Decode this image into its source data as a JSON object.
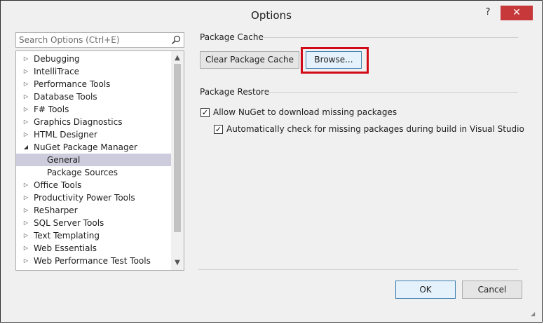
{
  "window": {
    "title": "Options",
    "help_label": "?",
    "close_label": "✕"
  },
  "search": {
    "placeholder": "Search Options (Ctrl+E)"
  },
  "tree": {
    "items": [
      {
        "label": "Debugging",
        "expanded": false,
        "level": 0
      },
      {
        "label": "IntelliTrace",
        "expanded": false,
        "level": 0
      },
      {
        "label": "Performance Tools",
        "expanded": false,
        "level": 0
      },
      {
        "label": "Database Tools",
        "expanded": false,
        "level": 0
      },
      {
        "label": "F# Tools",
        "expanded": false,
        "level": 0
      },
      {
        "label": "Graphics Diagnostics",
        "expanded": false,
        "level": 0
      },
      {
        "label": "HTML Designer",
        "expanded": false,
        "level": 0
      },
      {
        "label": "NuGet Package Manager",
        "expanded": true,
        "level": 0
      },
      {
        "label": "General",
        "level": 1,
        "selected": true
      },
      {
        "label": "Package Sources",
        "level": 1
      },
      {
        "label": "Office Tools",
        "expanded": false,
        "level": 0
      },
      {
        "label": "Productivity Power Tools",
        "expanded": false,
        "level": 0
      },
      {
        "label": "ReSharper",
        "expanded": false,
        "level": 0
      },
      {
        "label": "SQL Server Tools",
        "expanded": false,
        "level": 0
      },
      {
        "label": "Text Templating",
        "expanded": false,
        "level": 0
      },
      {
        "label": "Web Essentials",
        "expanded": false,
        "level": 0
      },
      {
        "label": "Web Performance Test Tools",
        "expanded": false,
        "level": 0
      }
    ]
  },
  "package_cache": {
    "section_label": "Package Cache",
    "clear_button": "Clear Package Cache",
    "browse_button": "Browse..."
  },
  "package_restore": {
    "section_label": "Package Restore",
    "allow_download_label": "Allow NuGet to download missing packages",
    "allow_download_checked": true,
    "auto_check_label": "Automatically check for missing packages during build in Visual Studio",
    "auto_check_checked": true
  },
  "footer": {
    "ok_button": "OK",
    "cancel_button": "Cancel"
  },
  "colors": {
    "close_button": "#c7383a",
    "highlight_box": "#d20a17",
    "selected_item": "#ccccdc"
  }
}
